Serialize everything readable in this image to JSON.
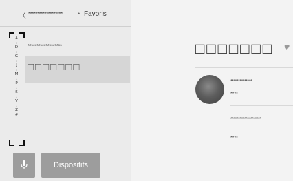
{
  "header": {
    "back_label": "〈",
    "crumb_hidden": "*******************",
    "crumb_sep": "•",
    "crumb_current": "Favoris"
  },
  "alphabet_index": [
    "A",
    ":",
    "D",
    ":",
    "G",
    ":",
    "J",
    ":",
    "M",
    ":",
    "P",
    ":",
    "S",
    ":",
    "V",
    ":",
    "Z",
    "#"
  ],
  "list": {
    "items": [
      {
        "label": "*******************"
      },
      {
        "label": "□□□□□□□"
      }
    ]
  },
  "bottom": {
    "mic_icon": "microphone-icon",
    "devices_label": "Dispositifs"
  },
  "detail": {
    "title": "□□□□□□□",
    "favorite_icon": "heart-icon",
    "entries": [
      {
        "name": "**************",
        "sub": "****"
      },
      {
        "name": "********************",
        "sub": "****"
      }
    ]
  },
  "colors": {
    "button_bg": "#9d9d9d",
    "selected_row": "#d6d6d6",
    "background": "#efefef"
  }
}
